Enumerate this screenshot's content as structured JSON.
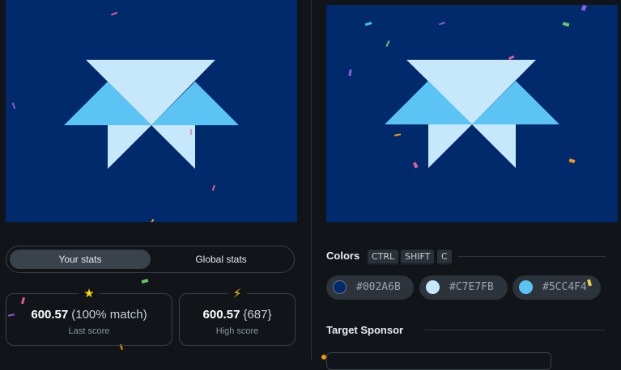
{
  "stats_toggle": {
    "your_stats": "Your stats",
    "global_stats": "Global stats"
  },
  "last_score": {
    "icon": "star-icon",
    "value": "600.57",
    "extra": "(100% match)",
    "label": "Last score"
  },
  "high_score": {
    "icon": "lightning-icon",
    "value": "600.57",
    "extra": "{687}",
    "label": "High score"
  },
  "colors_section": {
    "title": "Colors",
    "shortcut": [
      "CTRL",
      "SHIFT",
      "C"
    ],
    "swatches": [
      {
        "color": "#002a6b",
        "hex": "#002A6B"
      },
      {
        "color": "#c7e7fb",
        "hex": "#C7E7FB"
      },
      {
        "color": "#5cc4f4",
        "hex": "#5CC4F4"
      }
    ]
  },
  "sponsor_section": {
    "title": "Target Sponsor"
  },
  "palette": {
    "background": "#002a6b",
    "light": "#c7e7fb",
    "accent": "#5cc4f4"
  }
}
